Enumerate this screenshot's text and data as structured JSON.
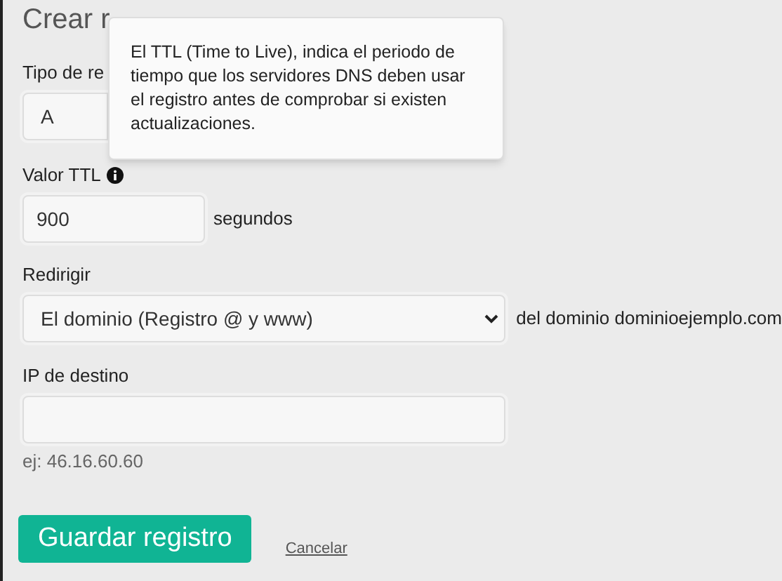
{
  "heading": "Crear r",
  "type_field": {
    "label": "Tipo de re",
    "value": "A"
  },
  "tooltip": "El TTL (Time to Live), indica el periodo de tiempo que los servidores DNS deben usar el registro antes de comprobar si existen actualizaciones.",
  "ttl": {
    "label": "Valor TTL",
    "value": "900",
    "unit": "segundos"
  },
  "redirect": {
    "label": "Redirigir",
    "value": "El dominio (Registro @ y www)",
    "suffix": "del dominio dominioejemplo.com"
  },
  "ip": {
    "label": "IP de destino",
    "hint": "ej: 46.16.60.60"
  },
  "buttons": {
    "save": "Guardar registro",
    "cancel": "Cancelar"
  }
}
